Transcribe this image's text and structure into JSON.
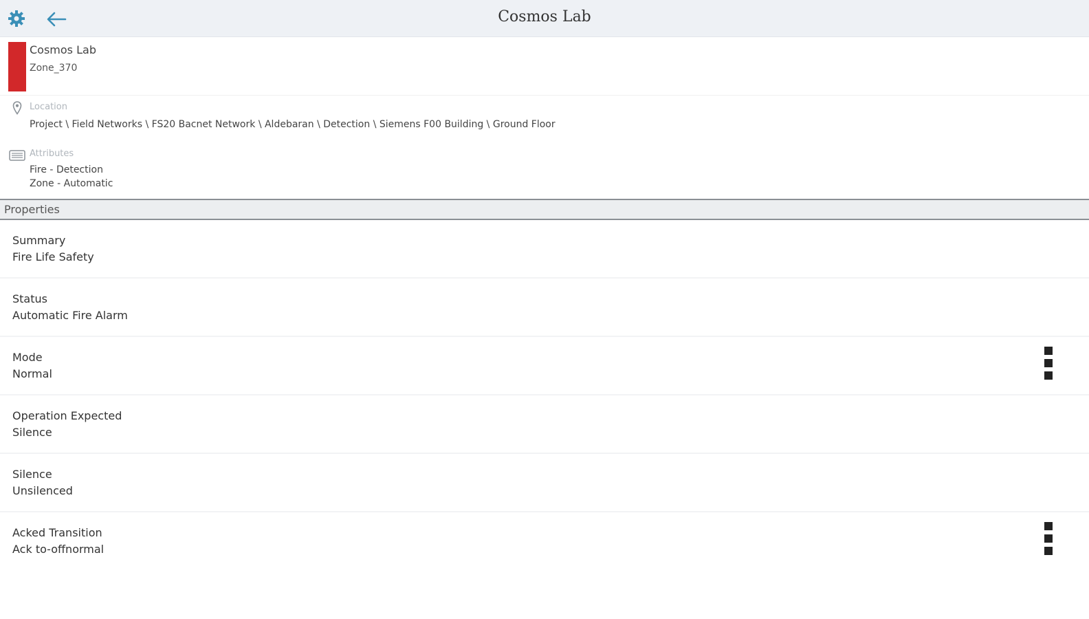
{
  "app_bar": {
    "title": "Cosmos Lab",
    "icons": [
      "gear-icon",
      "back-arrow-icon"
    ],
    "accent_color": "#3a8fb7"
  },
  "object_header": {
    "name": "Cosmos Lab",
    "subtitle": "Zone_370",
    "status_color": "#d2282a"
  },
  "location": {
    "label": "Location",
    "path": "Project \\ Field Networks \\ FS20 Bacnet Network \\ Aldebaran \\ Detection \\ Siemens F00 Building \\ Ground Floor"
  },
  "attributes": {
    "label": "Attributes",
    "values": [
      "Fire - Detection",
      "Zone - Automatic"
    ]
  },
  "properties": {
    "section_label": "Properties",
    "items": [
      {
        "label": "Summary",
        "value": "Fire Life Safety"
      },
      {
        "label": "Status",
        "value": "Automatic Fire Alarm"
      },
      {
        "label": "Mode",
        "value": "Normal"
      },
      {
        "label": "Operation Expected",
        "value": "Silence"
      },
      {
        "label": "Silence",
        "value": "Unsilenced"
      },
      {
        "label": "Acked Transition",
        "value": "Ack to-offnormal"
      }
    ]
  }
}
